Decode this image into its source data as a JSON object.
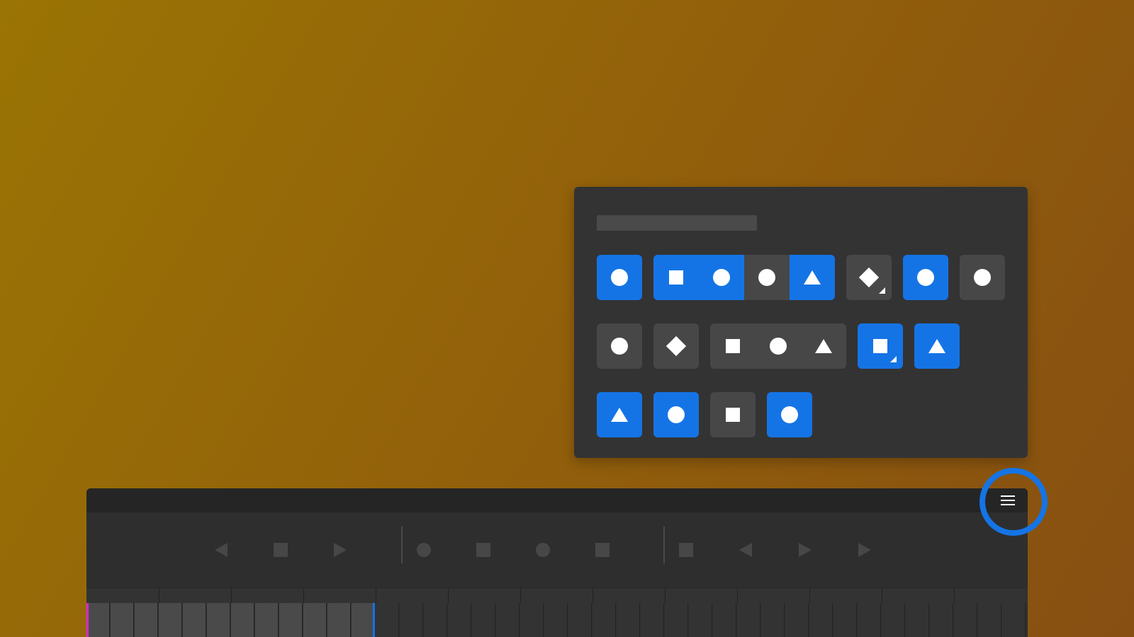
{
  "panel": {
    "rows": [
      {
        "buttons": [
          {
            "name": "circle-button",
            "segments": [
              {
                "shape": "circle",
                "color": "blue"
              }
            ]
          },
          {
            "name": "shape-group-button",
            "segments": [
              {
                "shape": "square",
                "color": "blue"
              },
              {
                "shape": "circle",
                "color": "blue"
              },
              {
                "shape": "circle",
                "color": "grey"
              },
              {
                "shape": "triangle",
                "color": "blue"
              }
            ]
          },
          {
            "name": "diamond-button",
            "segments": [
              {
                "shape": "diamond",
                "color": "grey",
                "corner": true
              }
            ]
          },
          {
            "name": "circle-button",
            "segments": [
              {
                "shape": "circle",
                "color": "blue"
              }
            ]
          },
          {
            "name": "circle-button",
            "segments": [
              {
                "shape": "circle",
                "color": "grey"
              }
            ]
          }
        ]
      },
      {
        "buttons": [
          {
            "name": "circle-button",
            "segments": [
              {
                "shape": "circle",
                "color": "grey"
              }
            ]
          },
          {
            "name": "diamond-button",
            "segments": [
              {
                "shape": "diamond",
                "color": "grey"
              }
            ]
          },
          {
            "name": "shape-group-button",
            "segments": [
              {
                "shape": "square",
                "color": "grey"
              },
              {
                "shape": "circle",
                "color": "grey"
              },
              {
                "shape": "triangle",
                "color": "grey"
              }
            ]
          },
          {
            "name": "square-button",
            "segments": [
              {
                "shape": "square",
                "color": "blue",
                "corner": true
              }
            ]
          },
          {
            "name": "triangle-button",
            "segments": [
              {
                "shape": "triangle",
                "color": "blue"
              }
            ]
          }
        ]
      },
      {
        "buttons": [
          {
            "name": "triangle-button",
            "segments": [
              {
                "shape": "triangle",
                "color": "blue"
              }
            ]
          },
          {
            "name": "circle-button",
            "segments": [
              {
                "shape": "circle",
                "color": "blue"
              }
            ]
          },
          {
            "name": "square-button",
            "segments": [
              {
                "shape": "square",
                "color": "grey"
              }
            ]
          },
          {
            "name": "circle-button",
            "segments": [
              {
                "shape": "circle",
                "color": "blue"
              }
            ]
          }
        ]
      }
    ]
  },
  "transport": {
    "menu_icon": "hamburger-menu-icon",
    "controls": [
      "triangle-left",
      "square",
      "triangle-right",
      "separator",
      "circle",
      "square",
      "circle",
      "square",
      "separator",
      "square",
      "triangle-left",
      "triangle-right",
      "triangle-right"
    ],
    "track_filled_cells": 12,
    "track_total_cells": 39
  },
  "colors": {
    "accent": "#1574e5",
    "panel_bg": "#333333",
    "button_grey": "#474747",
    "start_marker": "#d42ad0"
  }
}
